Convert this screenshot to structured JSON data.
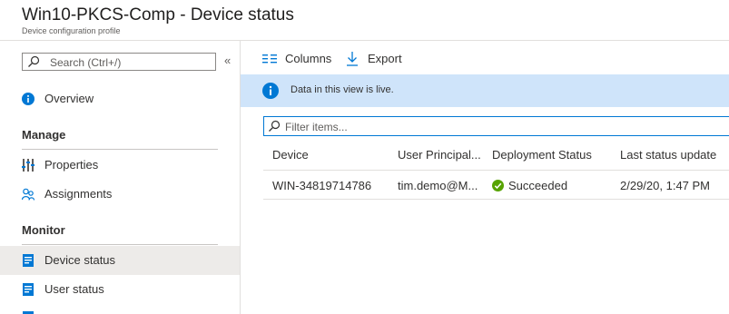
{
  "header": {
    "title": "Win10-PKCS-Comp - Device status",
    "subtitle": "Device configuration profile"
  },
  "sidebar": {
    "search_placeholder": "Search (Ctrl+/)",
    "collapse_glyph": "«",
    "overview": "Overview",
    "sections": {
      "manage": "Manage",
      "monitor": "Monitor"
    },
    "manage_items": [
      "Properties",
      "Assignments"
    ],
    "monitor_items": [
      "Device status",
      "User status"
    ],
    "selected": "Device status"
  },
  "toolbar": {
    "columns_label": "Columns",
    "export_label": "Export"
  },
  "banner": {
    "text": "Data in this view is live."
  },
  "filter": {
    "placeholder": "Filter items..."
  },
  "table": {
    "columns": [
      "Device",
      "User Principal...",
      "Deployment Status",
      "Last status update"
    ],
    "rows": [
      {
        "device": "WIN-34819714786",
        "user": "tim.demo@M...",
        "status": "Succeeded",
        "last_update": "2/29/20, 1:47 PM"
      }
    ]
  },
  "colors": {
    "accent": "#0078d4",
    "banner_bg": "#cfe4fa",
    "success": "#57a300",
    "selected_bg": "#edebe9"
  }
}
